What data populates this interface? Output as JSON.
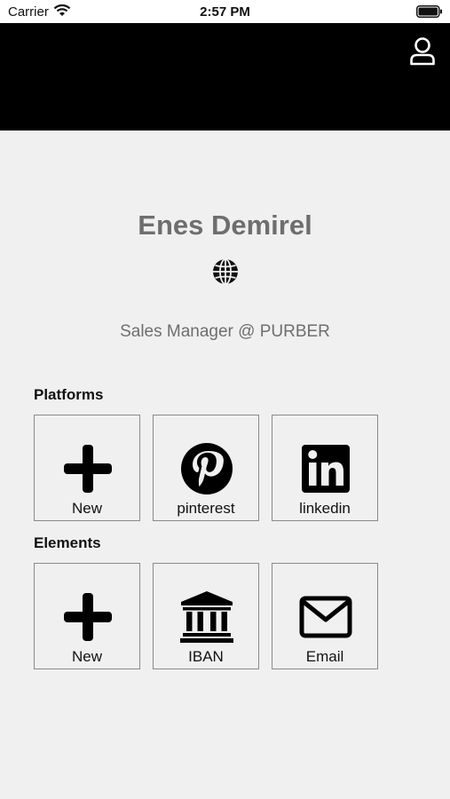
{
  "status_bar": {
    "carrier": "Carrier",
    "time": "2:57 PM"
  },
  "header": {
    "profile_icon": "person-icon"
  },
  "profile": {
    "name": "Enes Demirel",
    "website_icon": "globe-icon",
    "subtitle": "Sales Manager @ PURBER"
  },
  "platforms": {
    "title": "Platforms",
    "items": [
      {
        "label": "New",
        "icon": "plus-icon"
      },
      {
        "label": "pinterest",
        "icon": "pinterest-icon"
      },
      {
        "label": "linkedin",
        "icon": "linkedin-icon"
      }
    ]
  },
  "elements": {
    "title": "Elements",
    "items": [
      {
        "label": "New",
        "icon": "plus-icon"
      },
      {
        "label": "IBAN",
        "icon": "bank-icon"
      },
      {
        "label": "Email",
        "icon": "envelope-icon"
      }
    ]
  }
}
